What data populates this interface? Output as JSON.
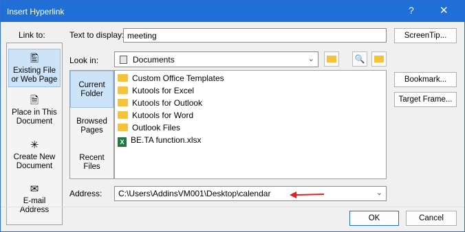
{
  "title": "Insert Hyperlink",
  "controls": {
    "help": "?",
    "close": "✕"
  },
  "link_to": {
    "label": "Link to:",
    "items": [
      {
        "label_line1": "Existing File",
        "label_line2": "or Web Page",
        "icon": "web-page-icon",
        "selected": true
      },
      {
        "label_line1": "Place in This",
        "label_line2": "Document",
        "icon": "document-place-icon"
      },
      {
        "label_line1": "Create New",
        "label_line2": "Document",
        "icon": "new-document-icon"
      },
      {
        "label_line1": "E-mail",
        "label_line2": "Address",
        "icon": "email-icon"
      }
    ]
  },
  "text_to_display": {
    "label": "Text to display:",
    "value": "meeting"
  },
  "screentip_label": "ScreenTip...",
  "look_in": {
    "label": "Look in:",
    "value": "Documents"
  },
  "side_nav": [
    {
      "line1": "Current",
      "line2": "Folder",
      "selected": true
    },
    {
      "line1": "Browsed",
      "line2": "Pages"
    },
    {
      "line1": "Recent",
      "line2": "Files"
    }
  ],
  "files": [
    {
      "name": "Custom Office Templates",
      "type": "folder"
    },
    {
      "name": "Kutools for Excel",
      "type": "folder"
    },
    {
      "name": "Kutools for Outlook",
      "type": "folder"
    },
    {
      "name": "Kutools for Word",
      "type": "folder"
    },
    {
      "name": "Outlook Files",
      "type": "folder"
    },
    {
      "name": "BE.TA function.xlsx",
      "type": "excel"
    }
  ],
  "address": {
    "label": "Address:",
    "value": "C:\\Users\\AddinsVM001\\Desktop\\calendar"
  },
  "buttons": {
    "bookmark": "Bookmark...",
    "target_frame": "Target Frame...",
    "ok": "OK",
    "cancel": "Cancel"
  },
  "colors": {
    "titlebar": "#1f6fd6",
    "selection": "#cde3f8",
    "arrow": "#e02020"
  }
}
